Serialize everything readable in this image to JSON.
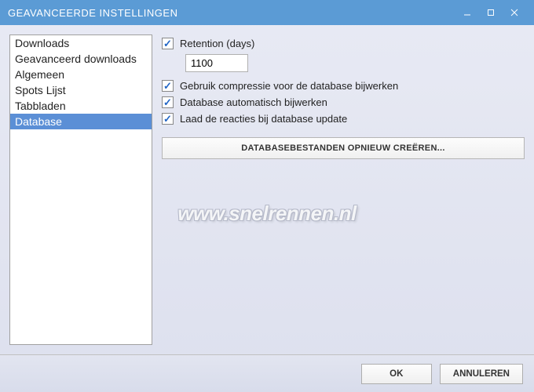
{
  "window": {
    "title": "GEAVANCEERDE INSTELLINGEN"
  },
  "sidebar": {
    "items": [
      {
        "label": "Downloads"
      },
      {
        "label": "Geavanceerd downloads"
      },
      {
        "label": "Algemeen"
      },
      {
        "label": "Spots Lijst"
      },
      {
        "label": "Tabbladen"
      },
      {
        "label": "Database"
      }
    ]
  },
  "content": {
    "retention_label": "Retention (days)",
    "retention_value": "1100",
    "compression_label": "Gebruik compressie voor de database bijwerken",
    "auto_update_label": "Database automatisch bijwerken",
    "load_comments_label": "Laad de reacties bij database update",
    "recreate_button": "DATABASEBESTANDEN OPNIEUW CREËREN..."
  },
  "buttons": {
    "ok": "OK",
    "cancel": "ANNULEREN"
  },
  "watermark": "www.snelrennen.nl"
}
